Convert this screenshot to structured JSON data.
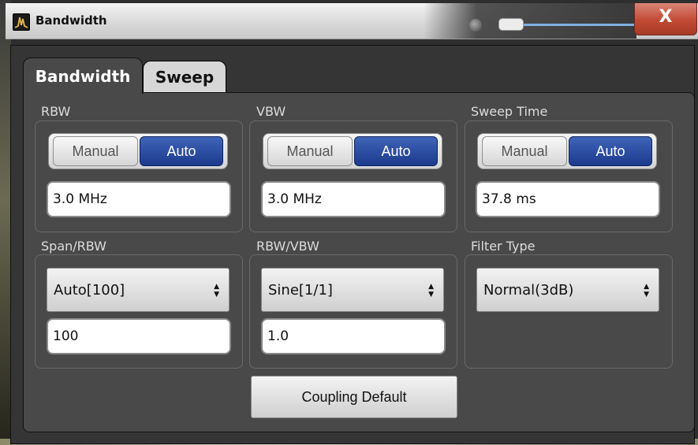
{
  "window": {
    "title": "Bandwidth",
    "close_glyph": "X",
    "icon": "spectrum-app-icon"
  },
  "tabs": [
    {
      "label": "Bandwidth",
      "active": true
    },
    {
      "label": "Sweep",
      "active": false
    }
  ],
  "rbw": {
    "label": "RBW",
    "manual": "Manual",
    "auto": "Auto",
    "selected": "Auto",
    "value": "3.0 MHz"
  },
  "vbw": {
    "label": "VBW",
    "manual": "Manual",
    "auto": "Auto",
    "selected": "Auto",
    "value": "3.0 MHz"
  },
  "sweep_time": {
    "label": "Sweep Time",
    "manual": "Manual",
    "auto": "Auto",
    "selected": "Auto",
    "value": "37.8 ms"
  },
  "span_rbw": {
    "label": "Span/RBW",
    "selected": "Auto[100]",
    "value": "100"
  },
  "rbw_vbw": {
    "label": "RBW/VBW",
    "selected": "Sine[1/1]",
    "value": "1.0"
  },
  "filter_type": {
    "label": "Filter Type",
    "selected": "Normal(3dB)"
  },
  "buttons": {
    "coupling_default": "Coupling Default"
  },
  "colors": {
    "auto_active": "#1c3a8e",
    "close_button": "#c24a34",
    "panel": "#494949"
  }
}
